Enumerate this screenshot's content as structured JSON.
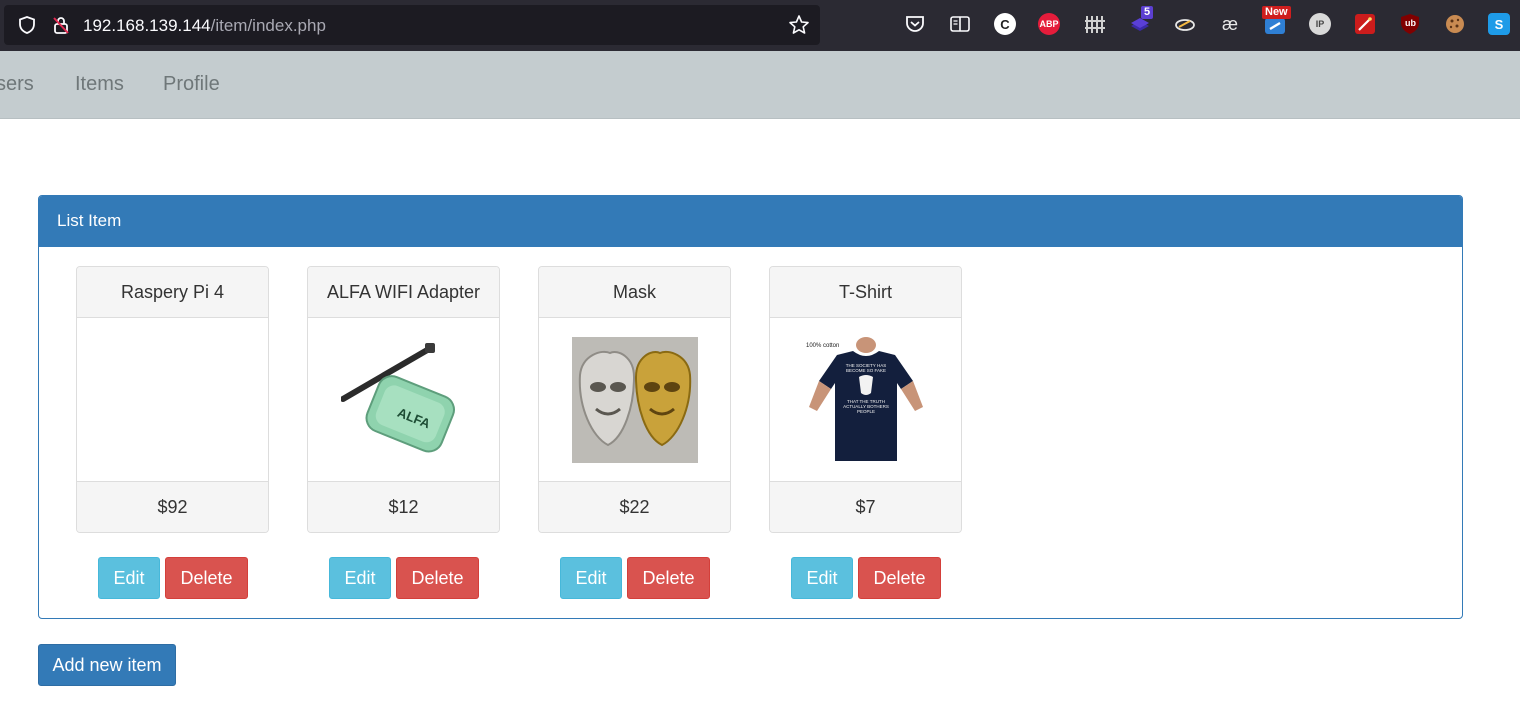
{
  "browser": {
    "url_host": "192.168.139.144",
    "url_path": "/item/index.php",
    "extensions": [
      {
        "icon": "pocket-icon"
      },
      {
        "icon": "reader-view-icon"
      },
      {
        "icon": "c-extension-icon",
        "label": "C"
      },
      {
        "icon": "adblock-plus-icon",
        "label": "ABP"
      },
      {
        "icon": "fence-icon"
      },
      {
        "icon": "stack-extension-icon",
        "badge": "5"
      },
      {
        "icon": "aim-extension-icon"
      },
      {
        "icon": "ae-extension-icon",
        "label": "æ"
      },
      {
        "icon": "s-new-extension-icon",
        "badge": "New"
      },
      {
        "icon": "ip-extension-icon",
        "label": "IP"
      },
      {
        "icon": "wand-extension-icon"
      },
      {
        "icon": "ublock-origin-icon",
        "label": "ub"
      },
      {
        "icon": "cookie-extension-icon"
      },
      {
        "icon": "s-blue-extension-icon",
        "label": "S"
      }
    ]
  },
  "nav": {
    "users": "sers",
    "items": "Items",
    "profile": "Profile"
  },
  "panel": {
    "title": "List Item"
  },
  "items": [
    {
      "name": "Raspery Pi 4",
      "price": "$92",
      "edit": "Edit",
      "delete": "Delete"
    },
    {
      "name": "ALFA WIFI Adapter",
      "price": "$12",
      "edit": "Edit",
      "delete": "Delete"
    },
    {
      "name": "Mask",
      "price": "$22",
      "edit": "Edit",
      "delete": "Delete"
    },
    {
      "name": "T-Shirt",
      "price": "$7",
      "edit": "Edit",
      "delete": "Delete"
    }
  ],
  "tshirt_print": {
    "tag": "100% cotton",
    "line1": "THE SOCIETY HAS",
    "line2": "BECOME SO FAKE",
    "line3": "THAT THE TRUTH",
    "line4": "ACTUALLY BOTHERS",
    "line5": "PEOPLE"
  },
  "alfa_logo": "ALFA",
  "add_button": "Add new item",
  "colors": {
    "primary": "#337ab7",
    "info": "#5bc0de",
    "danger": "#d9534f",
    "navbar": "#c4cccf"
  }
}
